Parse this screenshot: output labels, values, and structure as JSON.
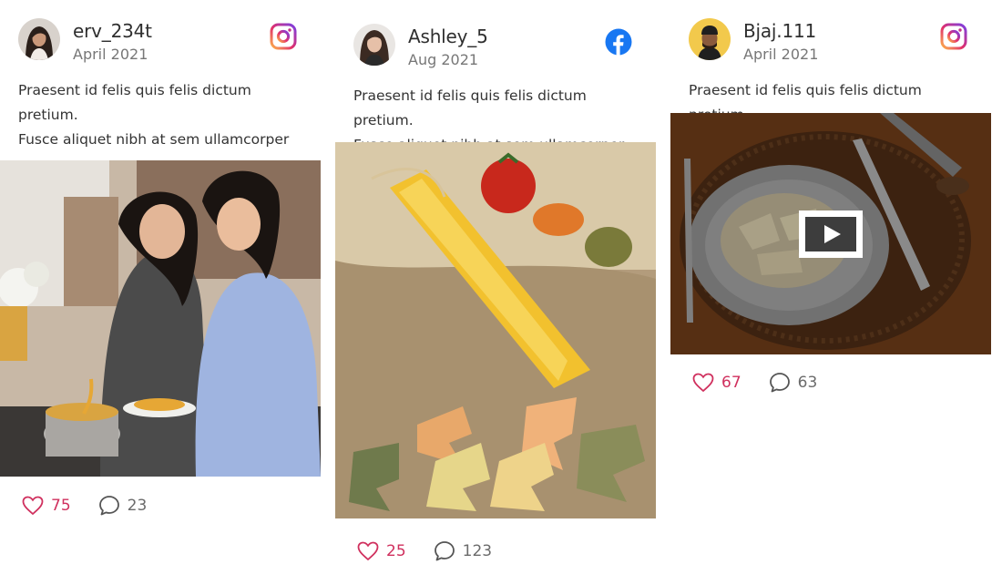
{
  "posts": [
    {
      "username": "erv_234t",
      "date": "April 2021",
      "network": "instagram-icon",
      "text_lines": [
        "Praesent id felis quis felis dictum pretium.",
        "Fusce aliquet nibh at sem ullamcorper"
      ],
      "media_type": "photo",
      "likes": "75",
      "comments": "23"
    },
    {
      "username": "Ashley_5",
      "date": "Aug 2021",
      "network": "facebook-icon",
      "text_lines": [
        "Praesent id felis quis felis dictum pretium.",
        "Fusce aliquet nibh at sem ullamcorper"
      ],
      "media_type": "photo",
      "likes": "25",
      "comments": "123"
    },
    {
      "username": "Bjaj.111",
      "date": "April 2021",
      "network": "instagram-icon",
      "text_lines": [
        "Praesent id felis quis felis dictum pretium."
      ],
      "media_type": "video",
      "likes": "67",
      "comments": "63"
    }
  ],
  "colors": {
    "like": "#d0305e",
    "facebook": "#1877f2",
    "text": "#333333",
    "muted": "#777777"
  }
}
